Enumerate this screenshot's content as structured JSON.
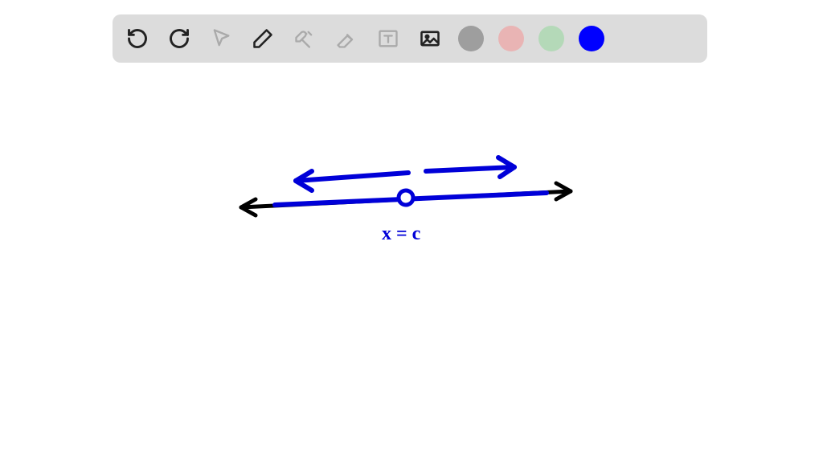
{
  "toolbar": {
    "tools": [
      {
        "name": "undo",
        "enabled": true
      },
      {
        "name": "redo",
        "enabled": true
      },
      {
        "name": "pointer",
        "enabled": false
      },
      {
        "name": "pencil",
        "enabled": true
      },
      {
        "name": "tools-settings",
        "enabled": false
      },
      {
        "name": "eraser",
        "enabled": false
      },
      {
        "name": "text-box",
        "enabled": false
      },
      {
        "name": "image-insert",
        "enabled": true
      }
    ],
    "colors": [
      {
        "name": "gray",
        "hex": "#9e9e9e",
        "selected": false
      },
      {
        "name": "pink",
        "hex": "#e9b4b4",
        "selected": false
      },
      {
        "name": "green",
        "hex": "#b4d9b8",
        "selected": false
      },
      {
        "name": "blue",
        "hex": "#0000ff",
        "selected": true
      }
    ]
  },
  "canvas": {
    "annotation_label": "x = c",
    "strokes": {
      "black_line_color": "#000000",
      "blue_line_color": "#0000d8"
    }
  }
}
